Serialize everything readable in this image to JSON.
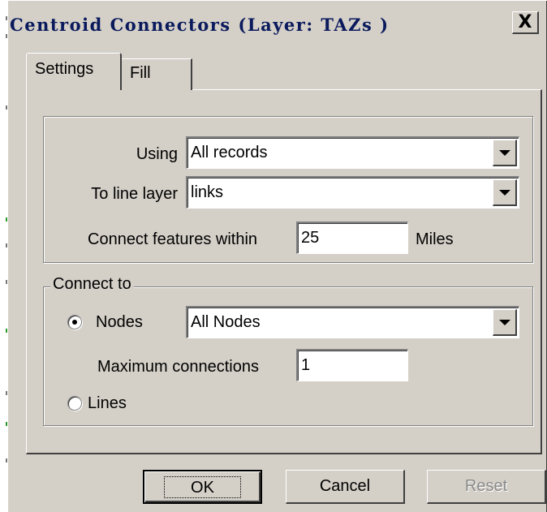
{
  "window": {
    "title": "Centroid Connectors (Layer: TAZs )",
    "close_symbol": "X"
  },
  "tabs": [
    {
      "label": "Settings",
      "active": true
    },
    {
      "label": "Fill",
      "active": false
    }
  ],
  "settings": {
    "using_label": "Using",
    "using_value": "All records",
    "line_layer_label": "To line layer",
    "line_layer_value": "links",
    "within_label": "Connect features within",
    "within_value": "25",
    "within_unit": "Miles"
  },
  "connect_to": {
    "group_label": "Connect to",
    "nodes_label": "Nodes",
    "nodes_selected": true,
    "nodes_value": "All Nodes",
    "max_label": "Maximum connections",
    "max_value": "1",
    "lines_label": "Lines",
    "lines_selected": false
  },
  "buttons": {
    "ok": "OK",
    "cancel": "Cancel",
    "reset": "Reset"
  }
}
